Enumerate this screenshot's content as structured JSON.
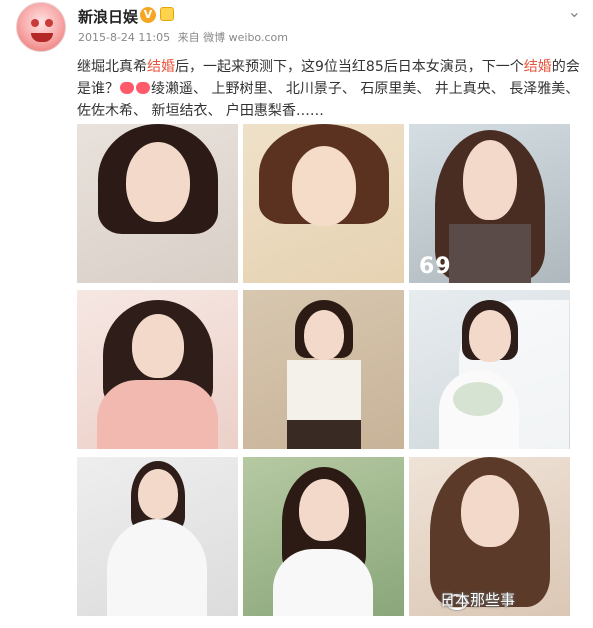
{
  "header": {
    "username": "新浪日娱",
    "vip_mark": "V",
    "timestamp": "2015-8-24 11:05",
    "source": "来自 微博 weibo.com",
    "menu_icon": "chevron-down-icon"
  },
  "post": {
    "text_a": "继堀北真希",
    "text_hl1": "结婚",
    "text_b": "后，一起来预测下，这9位当红85后日本女演员，下一个",
    "text_hl2": "结婚",
    "text_c": "的会是谁？",
    "names": "绫濑遥、 上野树里、 北川景子、 石原里美、 井上真央、 長泽雅美、 佐佐木希、 新垣结衣、 户田惠梨香……"
  },
  "photos": {
    "overlay_69": "69"
  },
  "watermark": {
    "text": "日本那些事"
  },
  "colors": {
    "highlight": "#e8553f",
    "username": "#222222",
    "meta": "#888888"
  }
}
